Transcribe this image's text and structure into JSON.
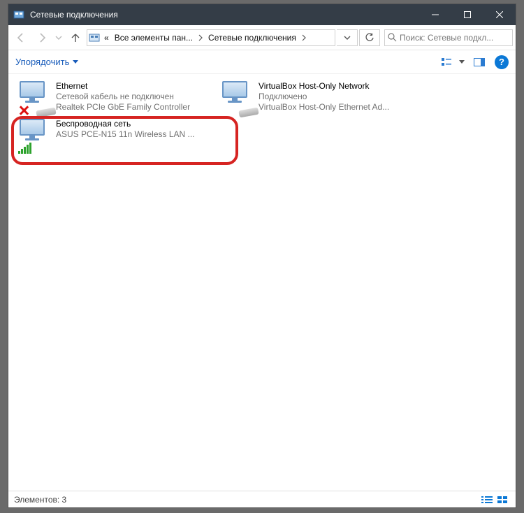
{
  "window": {
    "title": "Сетевые подключения"
  },
  "breadcrumbs": {
    "prefix": "«",
    "seg1": "Все элементы пан...",
    "seg2": "Сетевые подключения"
  },
  "search": {
    "placeholder": "Поиск: Сетевые подкл..."
  },
  "toolbar": {
    "organize": "Упорядочить"
  },
  "help": {
    "symbol": "?"
  },
  "connections": [
    {
      "name": "Ethernet",
      "status": "Сетевой кабель не подключен",
      "device": "Realtek PCIe GbE Family Controller",
      "overlay": "redx-plug"
    },
    {
      "name": "VirtualBox Host-Only Network",
      "status": "Подключено",
      "device": "VirtualBox Host-Only Ethernet Ad...",
      "overlay": "plug"
    },
    {
      "name": "Беспроводная сеть",
      "status": "",
      "device": "ASUS PCE-N15 11n Wireless LAN ...",
      "overlay": "wifi"
    }
  ],
  "statusbar": {
    "text": "Элементов: 3"
  }
}
